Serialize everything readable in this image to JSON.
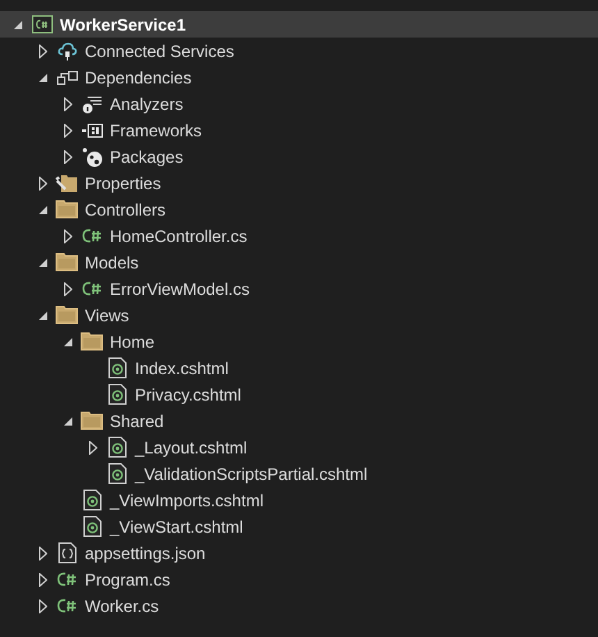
{
  "tree": [
    {
      "label": "WorkerService1",
      "kind": "project",
      "selected": true,
      "expanded": true,
      "children": [
        {
          "label": "Connected Services",
          "kind": "cloud",
          "selected": false,
          "expanded": false
        },
        {
          "label": "Dependencies",
          "kind": "dependencies",
          "selected": false,
          "expanded": true,
          "children": [
            {
              "label": "Analyzers",
              "kind": "analyzers",
              "selected": false,
              "expanded": false
            },
            {
              "label": "Frameworks",
              "kind": "frameworks",
              "selected": false,
              "expanded": false
            },
            {
              "label": "Packages",
              "kind": "packages",
              "selected": false,
              "expanded": false
            }
          ]
        },
        {
          "label": "Properties",
          "kind": "properties",
          "selected": false,
          "expanded": false
        },
        {
          "label": "Controllers",
          "kind": "folder",
          "selected": false,
          "expanded": true,
          "children": [
            {
              "label": "HomeController.cs",
              "kind": "csharp",
              "selected": false,
              "expanded": false
            }
          ]
        },
        {
          "label": "Models",
          "kind": "folder",
          "selected": false,
          "expanded": true,
          "children": [
            {
              "label": "ErrorViewModel.cs",
              "kind": "csharp",
              "selected": false,
              "expanded": false
            }
          ]
        },
        {
          "label": "Views",
          "kind": "folder",
          "selected": false,
          "expanded": true,
          "children": [
            {
              "label": "Home",
              "kind": "folder",
              "selected": false,
              "expanded": true,
              "children": [
                {
                  "label": "Index.cshtml",
                  "kind": "razor",
                  "selected": false
                },
                {
                  "label": "Privacy.cshtml",
                  "kind": "razor",
                  "selected": false
                }
              ]
            },
            {
              "label": "Shared",
              "kind": "folder",
              "selected": false,
              "expanded": true,
              "children": [
                {
                  "label": "_Layout.cshtml",
                  "kind": "razor",
                  "selected": false,
                  "expanded": false
                },
                {
                  "label": "_ValidationScriptsPartial.cshtml",
                  "kind": "razor",
                  "selected": false
                }
              ]
            },
            {
              "label": "_ViewImports.cshtml",
              "kind": "razor",
              "selected": false
            },
            {
              "label": "_ViewStart.cshtml",
              "kind": "razor",
              "selected": false
            }
          ]
        },
        {
          "label": "appsettings.json",
          "kind": "json",
          "selected": false,
          "expanded": false
        },
        {
          "label": "Program.cs",
          "kind": "csharp",
          "selected": false,
          "expanded": false
        },
        {
          "label": "Worker.cs",
          "kind": "csharp",
          "selected": false,
          "expanded": false
        }
      ]
    }
  ]
}
